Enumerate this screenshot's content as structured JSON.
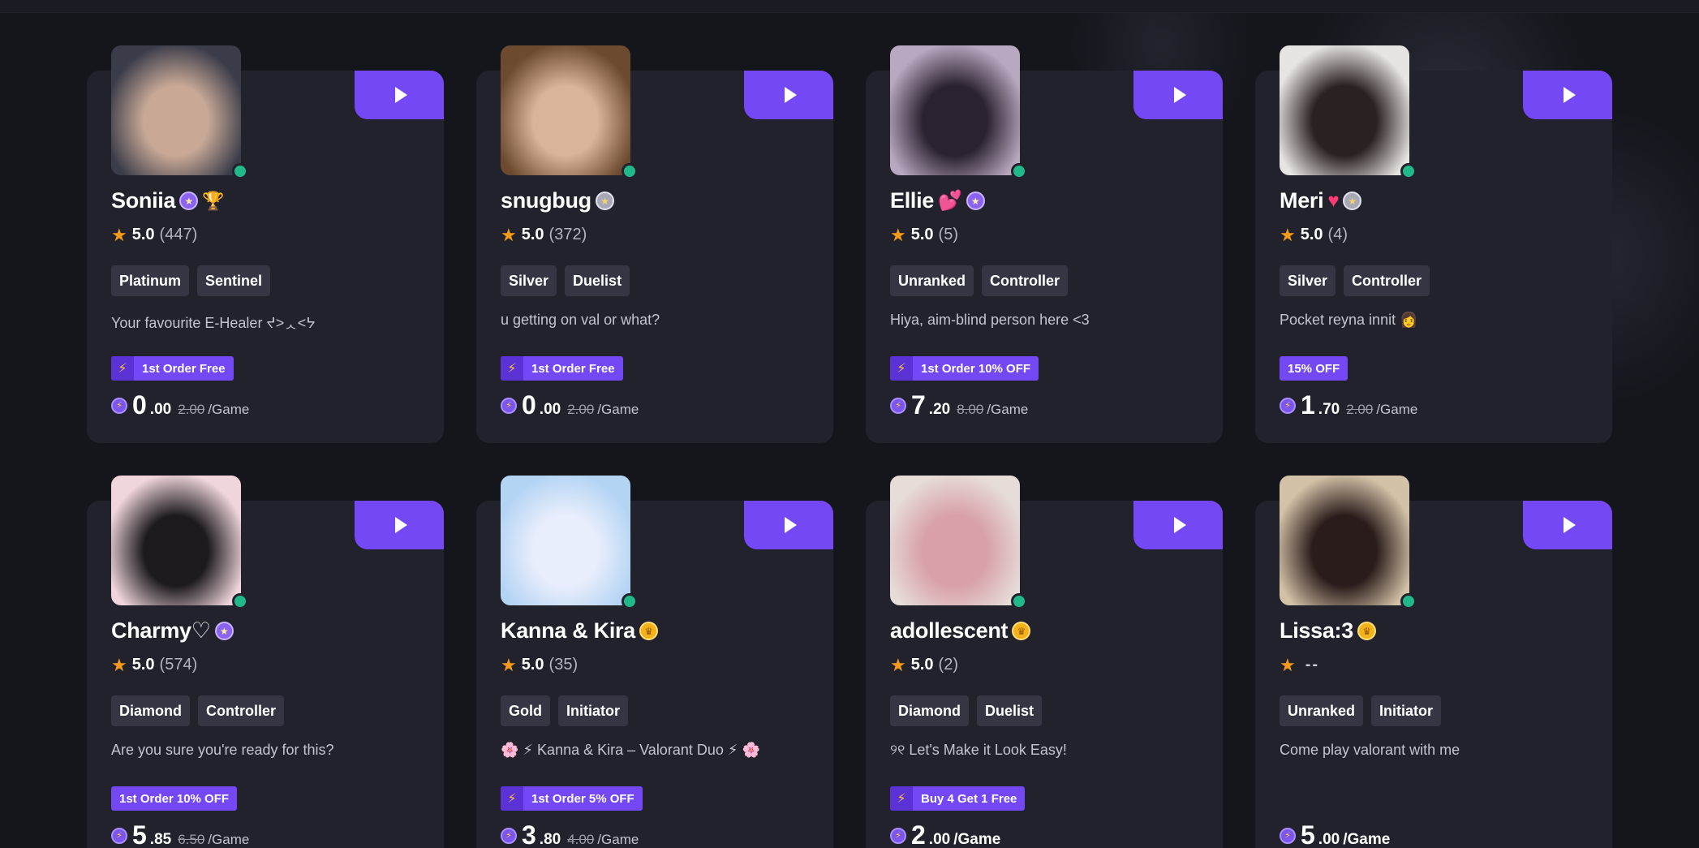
{
  "cards": [
    {
      "name": "Soniia",
      "badges": [
        "purple-medal-icon",
        "trophy-icon"
      ],
      "rating": "5.0",
      "reviews": "(447)",
      "tags": [
        "Platinum",
        "Sentinel"
      ],
      "description": "Your favourite E-Healer ᔪ˃ᆺ˂ᔭ",
      "promo": "1st Order Free",
      "promo_bolt": true,
      "price_int": "0",
      "price_dec": ".00",
      "price_old": "2.00",
      "price_unit": "/Game",
      "avatar_colors": [
        "#3a3c4a",
        "#c9a996"
      ]
    },
    {
      "name": "snugbug",
      "badges": [
        "silver-medal-icon"
      ],
      "rating": "5.0",
      "reviews": "(372)",
      "tags": [
        "Silver",
        "Duelist"
      ],
      "description": "u getting on val or what?",
      "promo": "1st Order Free",
      "promo_bolt": true,
      "price_int": "0",
      "price_dec": ".00",
      "price_old": "2.00",
      "price_unit": "/Game",
      "avatar_colors": [
        "#6b4a30",
        "#d8b49a"
      ]
    },
    {
      "name": "Ellie",
      "badges": [
        "hearts-icon",
        "purple-medal-icon"
      ],
      "rating": "5.0",
      "reviews": "(5)",
      "tags": [
        "Unranked",
        "Controller"
      ],
      "description": "Hiya, aim-blind person here <3",
      "promo": "1st Order 10% OFF",
      "promo_bolt": true,
      "price_int": "7",
      "price_dec": ".20",
      "price_old": "8.00",
      "price_unit": "/Game",
      "avatar_colors": [
        "#b8a8c0",
        "#2a2230"
      ]
    },
    {
      "name": "Meri",
      "badges": [
        "heart-icon",
        "silver-medal-icon"
      ],
      "rating": "5.0",
      "reviews": "(4)",
      "tags": [
        "Silver",
        "Controller"
      ],
      "description": "Pocket reyna innit 👩",
      "promo": "15% OFF",
      "promo_bolt": false,
      "price_int": "1",
      "price_dec": ".70",
      "price_old": "2.00",
      "price_unit": "/Game",
      "avatar_colors": [
        "#e8e4e2",
        "#2a2220"
      ]
    },
    {
      "name": "Charmy♡",
      "badges": [
        "purple-medal-icon"
      ],
      "rating": "5.0",
      "reviews": "(574)",
      "tags": [
        "Diamond",
        "Controller"
      ],
      "description": "Are you sure you're ready for this?",
      "promo": "1st Order 10% OFF",
      "promo_bolt": false,
      "price_int": "5",
      "price_dec": ".85",
      "price_old": "6.50",
      "price_unit": "/Game",
      "avatar_colors": [
        "#f0d6dc",
        "#1c1a1e"
      ]
    },
    {
      "name": "Kanna & Kira",
      "badges": [
        "gold-medal-icon"
      ],
      "rating": "5.0",
      "reviews": "(35)",
      "tags": [
        "Gold",
        "Initiator"
      ],
      "description": "🌸 ⚡ Kanna & Kira – Valorant Duo ⚡ 🌸",
      "promo": "1st Order 5% OFF",
      "promo_bolt": true,
      "price_int": "3",
      "price_dec": ".80",
      "price_old": "4.00",
      "price_unit": "/Game",
      "avatar_colors": [
        "#b4d4f4",
        "#e9eefc"
      ]
    },
    {
      "name": "adollescent",
      "badges": [
        "gold-medal-icon"
      ],
      "rating": "5.0",
      "reviews": "(2)",
      "tags": [
        "Diamond",
        "Duelist"
      ],
      "description": "୨୧ Let's Make it Look Easy!",
      "promo": "Buy 4 Get 1 Free",
      "promo_bolt": true,
      "price_int": "2",
      "price_dec": ".00",
      "price_old": "",
      "price_unit": " /Game",
      "avatar_colors": [
        "#e6dcd8",
        "#d8a0a8"
      ]
    },
    {
      "name": "Lissa:3",
      "badges": [
        "gold-medal-icon"
      ],
      "rating": "",
      "reviews": "--",
      "tags": [
        "Unranked",
        "Initiator"
      ],
      "description": "Come play valorant with me",
      "promo": "",
      "promo_bolt": false,
      "price_int": "5",
      "price_dec": ".00",
      "price_old": "",
      "price_unit": " /Game",
      "avatar_colors": [
        "#d4c2a8",
        "#2a1c1a"
      ]
    }
  ],
  "colors": {
    "accent": "#7448f5",
    "online": "#21b88a",
    "card": "#22222c",
    "tag": "#353543",
    "star": "#f59a1a"
  }
}
